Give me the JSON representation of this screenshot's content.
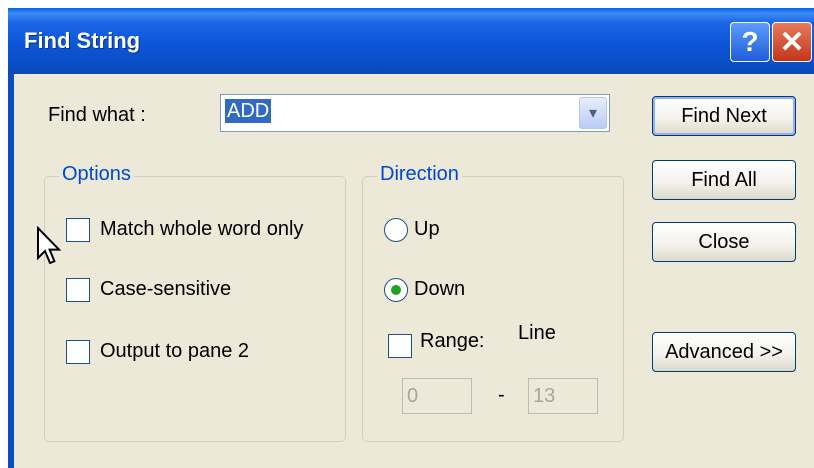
{
  "window": {
    "title": "Find String",
    "help_glyph": "?",
    "close_glyph": "✕"
  },
  "find_what": {
    "label": "Find what :",
    "value": "ADD",
    "dropdown_glyph": "▾"
  },
  "buttons": {
    "find_next": "Find Next",
    "find_all": "Find All",
    "close": "Close",
    "advanced": "Advanced >>"
  },
  "options": {
    "legend": "Options",
    "match_whole_word": {
      "label": "Match whole word only",
      "checked": false
    },
    "case_sensitive": {
      "label": "Case-sensitive",
      "checked": false
    },
    "output_pane2": {
      "label": "Output to pane 2",
      "checked": false
    }
  },
  "direction": {
    "legend": "Direction",
    "up": {
      "label": "Up",
      "selected": false
    },
    "down": {
      "label": "Down",
      "selected": true
    },
    "range": {
      "label": "Range:",
      "checked": false
    },
    "line_label": "Line",
    "from": "0",
    "separator": "-",
    "to": "13"
  },
  "colors": {
    "titlebar": "#0a4ec6",
    "legend_text": "#0046d5",
    "selection": "#316ac5",
    "radio_dot": "#21a121"
  }
}
